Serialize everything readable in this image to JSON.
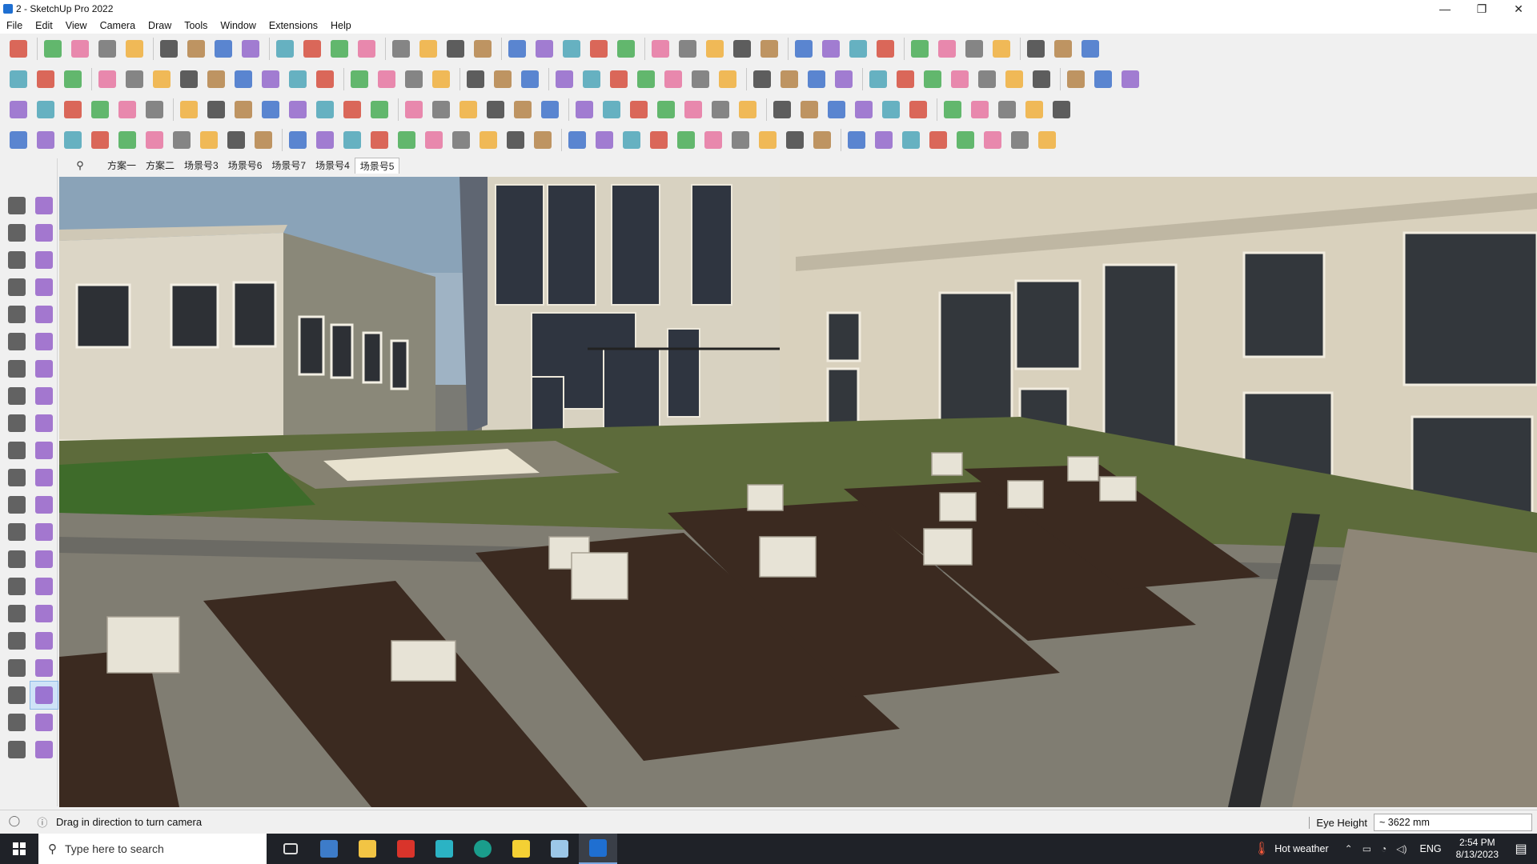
{
  "window": {
    "title": "2 - SketchUp Pro 2022",
    "controls": [
      "—",
      "❐",
      "✕"
    ]
  },
  "menu": [
    "File",
    "Edit",
    "View",
    "Camera",
    "Draw",
    "Tools",
    "Window",
    "Extensions",
    "Help"
  ],
  "scene_tabs": {
    "search_glyph": "⚲",
    "tabs": [
      "方案一",
      "方案二",
      "场景号3",
      "场景号6",
      "场景号7",
      "场景号4",
      "场景号5"
    ],
    "active_index": 6
  },
  "status": {
    "message": "Drag in direction to turn camera",
    "measurement_label": "Eye Height",
    "measurement_value": "~ 3622 mm"
  },
  "taskbar": {
    "search_placeholder": "Type here to search",
    "weather": "Hot weather",
    "language": "ENG",
    "time": "2:54 PM",
    "date": "8/13/2023"
  },
  "colors": {
    "accent": "#1f6fd1",
    "sky": "#9fb3c4",
    "facade": "#d9d1bd",
    "deck": "#3b2a20",
    "paving": "#807d72"
  }
}
